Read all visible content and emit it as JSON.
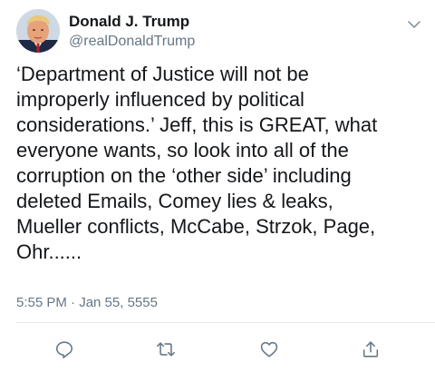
{
  "tweet": {
    "author": {
      "display_name": "Donald J. Trump",
      "handle": "@realDonaldTrump"
    },
    "text": "‘Department of Justice will not be\nimproperly influenced by political\nconsiderations.’ Jeff, this is GREAT, what\neveryone wants, so look into all of the\ncorruption on the ‘other side’ including\ndeleted Emails, Comey lies & leaks,\nMueller conflicts, McCabe, Strzok, Page,\nOhr......",
    "timestamp": "5:55 PM · Jan 55, 5555"
  },
  "icons": {
    "menu": "chevron-down-icon",
    "reply": "reply-icon",
    "retweet": "retweet-icon",
    "like": "heart-icon",
    "share": "share-icon"
  },
  "colors": {
    "text": "#14171a",
    "secondary": "#657786",
    "icon": "#657786",
    "divider": "#e6ecf0"
  }
}
